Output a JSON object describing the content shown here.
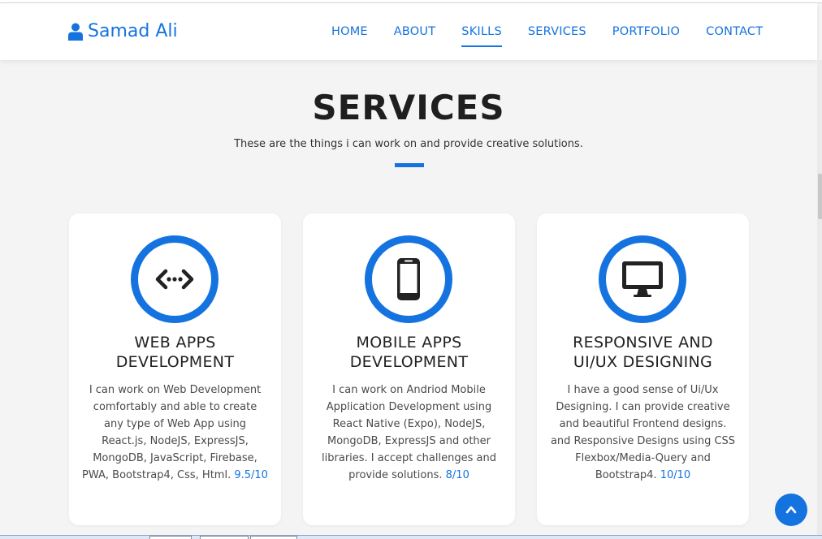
{
  "brand": {
    "name": "Samad Ali",
    "icon": "user-icon"
  },
  "nav": {
    "items": [
      "HOME",
      "ABOUT",
      "SKILLS",
      "SERVICES",
      "PORTFOLIO",
      "CONTACT"
    ],
    "active": "SKILLS"
  },
  "services": {
    "title": "SERVICES",
    "subtitle": "These are the things i can work on and provide creative solutions.",
    "cards": [
      {
        "icon": "code-icon",
        "title_line1": "WEB APPS",
        "title_line2": "DEVELOPMENT",
        "text": "I can work on Web Development comfortably and able to create any type of Web App using React.js, NodeJS, ExpressJS, MongoDB, JavaScript, Firebase, PWA, Bootstrap4, Css, Html.",
        "rating": "9.5/10"
      },
      {
        "icon": "mobile-icon",
        "title_line1": "MOBILE APPS",
        "title_line2": "DEVELOPMENT",
        "text": "I can work on Andriod Mobile Application Development using React Native (Expo), NodeJS, MongoDB, ExpressJS and other libraries. I accept challenges and provide solutions.",
        "rating": "8/10"
      },
      {
        "icon": "desktop-icon",
        "title_line1": "RESPONSIVE AND",
        "title_line2": "UI/UX DESIGNING",
        "text": "I have a good sense of Ui/Ux Designing. I can provide creative and beautiful Frontend designs. and Responsive Designs using CSS Flexbox/Media-Query and Bootstrap4.",
        "rating": "10/10"
      }
    ]
  },
  "scroll_top": {
    "icon": "chevron-up-icon"
  },
  "colors": {
    "accent": "#1573e0",
    "background": "#f4f4f4",
    "card": "#ffffff",
    "heading": "#1f1f1f"
  }
}
